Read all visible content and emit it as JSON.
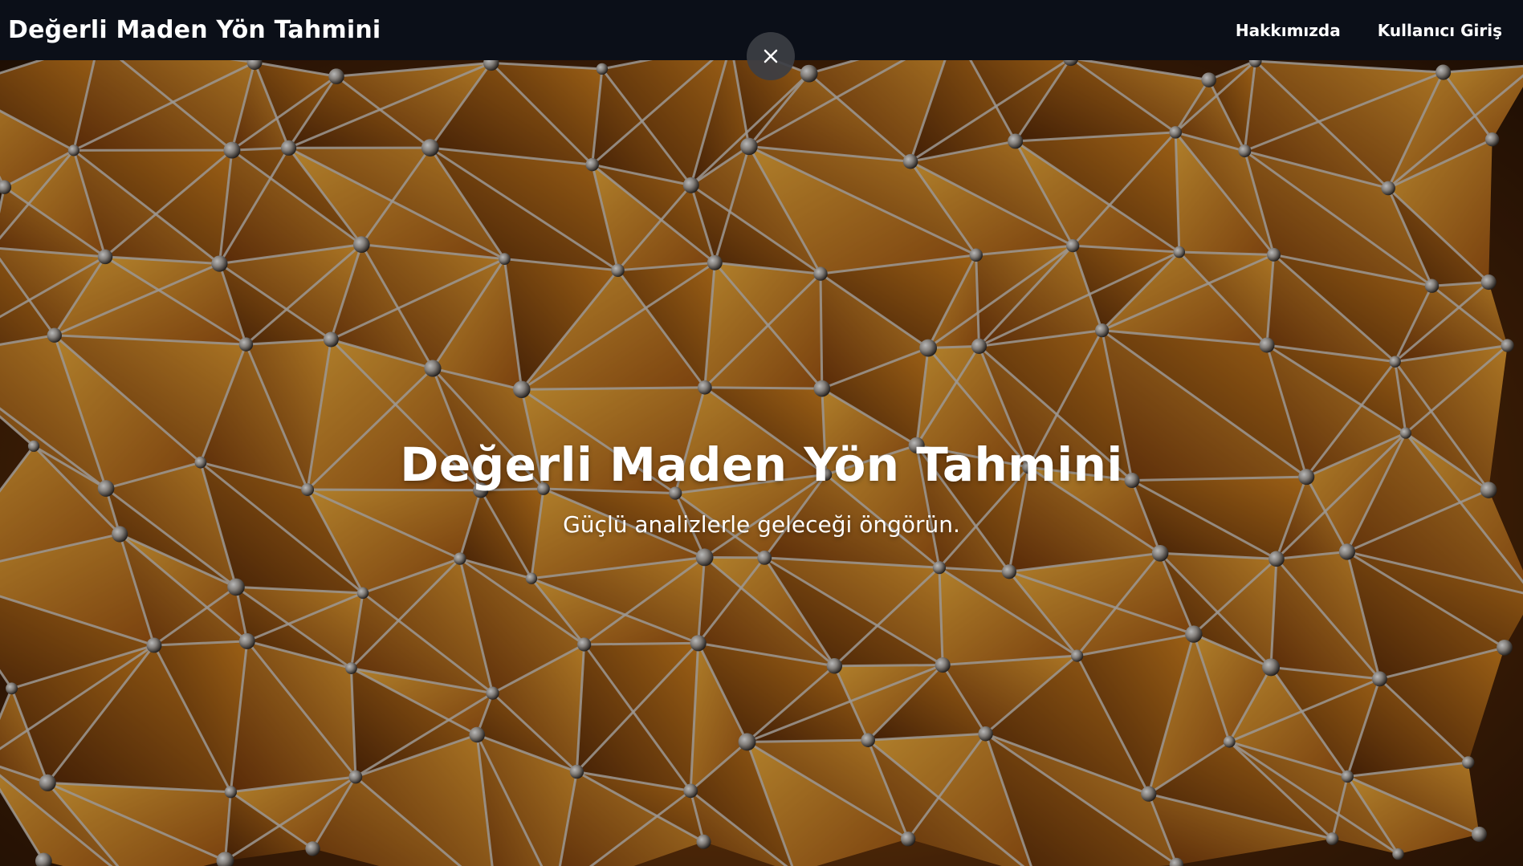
{
  "navbar": {
    "brand": "Değerli Maden Yön Tahmini",
    "links": [
      {
        "label": "Hakkımızda"
      },
      {
        "label": "Kullanıcı Giriş"
      }
    ]
  },
  "overlay": {
    "close_icon": "close-icon"
  },
  "hero": {
    "title": "Değerli Maden Yön Tahmini",
    "subtitle": "Güçlü analizlerle geleceği öngörün.",
    "background_description_colors": {
      "highlight": "#f2a93a",
      "mid": "#b8641a",
      "shadow": "#3a1b06",
      "network_lines": "#c9c3bd"
    }
  },
  "colors": {
    "navbar_bg": "#0b0f18",
    "text": "#ffffff",
    "close_button_bg": "#3c3e44"
  }
}
